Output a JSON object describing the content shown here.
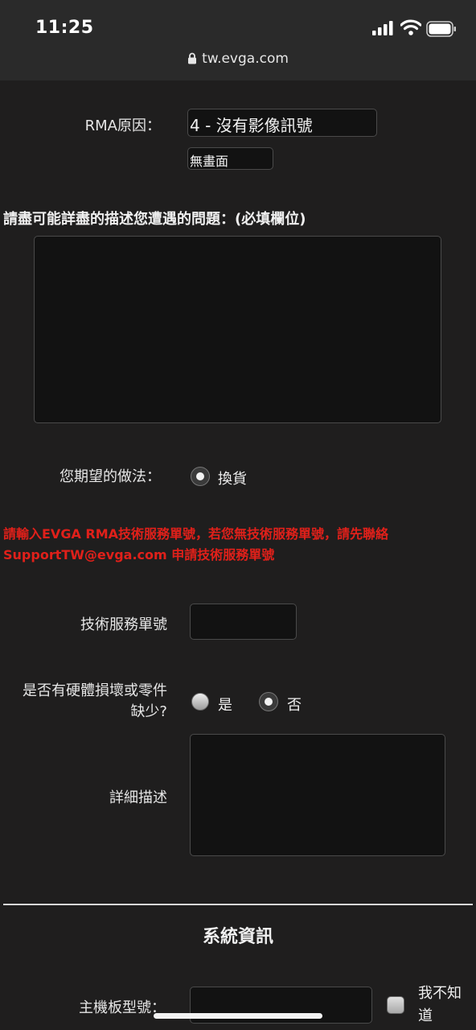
{
  "status_bar": {
    "time": "11:25",
    "url": "tw.evga.com"
  },
  "rma": {
    "label": "RMA原因：",
    "selected": "4 - 沒有影像訊號",
    "sub_value": "無畫面"
  },
  "description": {
    "heading": "請盡可能詳盡的描述您遭遇的問題：(必填欄位)",
    "value": ""
  },
  "expected": {
    "label": "您期望的做法：",
    "option": "換貨",
    "selected": true
  },
  "warning": {
    "line1": "請輸入EVGA RMA技術服務單號，若您無技術服務單號，請先聯絡",
    "line2": "SupportTW@evga.com 申請技術服務單號"
  },
  "ticket": {
    "label": "技術服務單號",
    "value": ""
  },
  "damage": {
    "label_line1": "是否有硬體損壞或零件",
    "label_line2": "缺少?",
    "yes": "是",
    "no": "否",
    "selected": "否"
  },
  "detail": {
    "label": "詳細描述",
    "value": ""
  },
  "system": {
    "title": "系統資訊"
  },
  "motherboard": {
    "label": "主機板型號：",
    "value": "",
    "dont_know_line1": "我不知",
    "dont_know_line2": "道"
  }
}
